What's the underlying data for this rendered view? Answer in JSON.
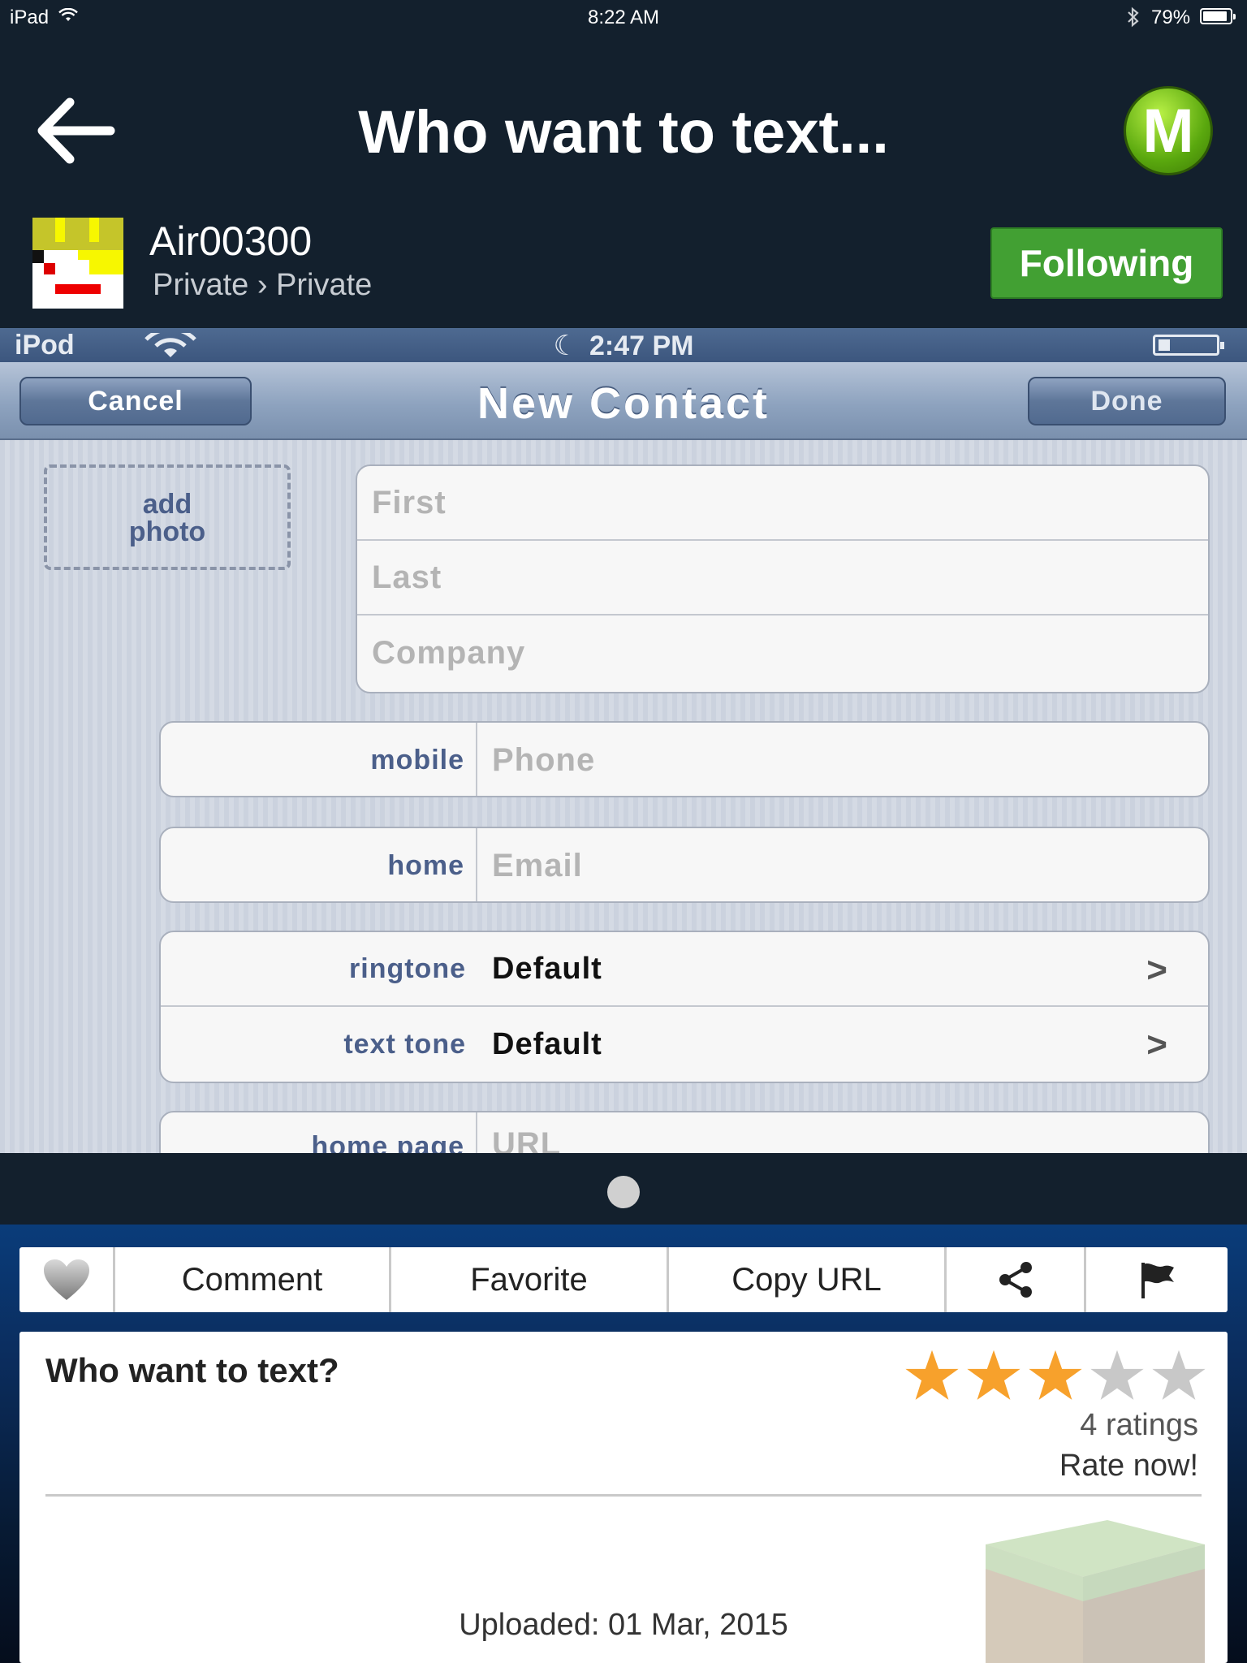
{
  "status_bar": {
    "carrier": "iPad",
    "time": "8:22 AM",
    "battery": "79%"
  },
  "header": {
    "title": "Who want to text...",
    "logo_letter": "M"
  },
  "user": {
    "name": "Air00300",
    "subtitle": "Private › Private",
    "follow_label": "Following"
  },
  "screenshot": {
    "status": {
      "carrier": "iPod",
      "time": "2:47 PM"
    },
    "nav": {
      "cancel": "Cancel",
      "title": "New Contact",
      "done": "Done"
    },
    "add_photo": "add\nphoto",
    "name_fields": [
      "First",
      "Last",
      "Company"
    ],
    "phone": {
      "label": "mobile",
      "placeholder": "Phone"
    },
    "email": {
      "label": "home",
      "placeholder": "Email"
    },
    "tones": [
      {
        "label": "ringtone",
        "value": "Default"
      },
      {
        "label": "text tone",
        "value": "Default"
      }
    ],
    "homepage": {
      "label": "home page",
      "placeholder": "URL"
    }
  },
  "toolbar": {
    "comment": "Comment",
    "favorite": "Favorite",
    "copy_url": "Copy URL"
  },
  "post": {
    "title": "Who want to text?",
    "rating_value": 3,
    "rating_max": 5,
    "ratings_count": "4 ratings",
    "rate_now": "Rate now!",
    "uploaded": "Uploaded: 01 Mar, 2015"
  },
  "colors": {
    "follow": "#42a033",
    "background": "#13202d",
    "star_on": "#f7a12c",
    "star_off": "#c8c8c8"
  }
}
